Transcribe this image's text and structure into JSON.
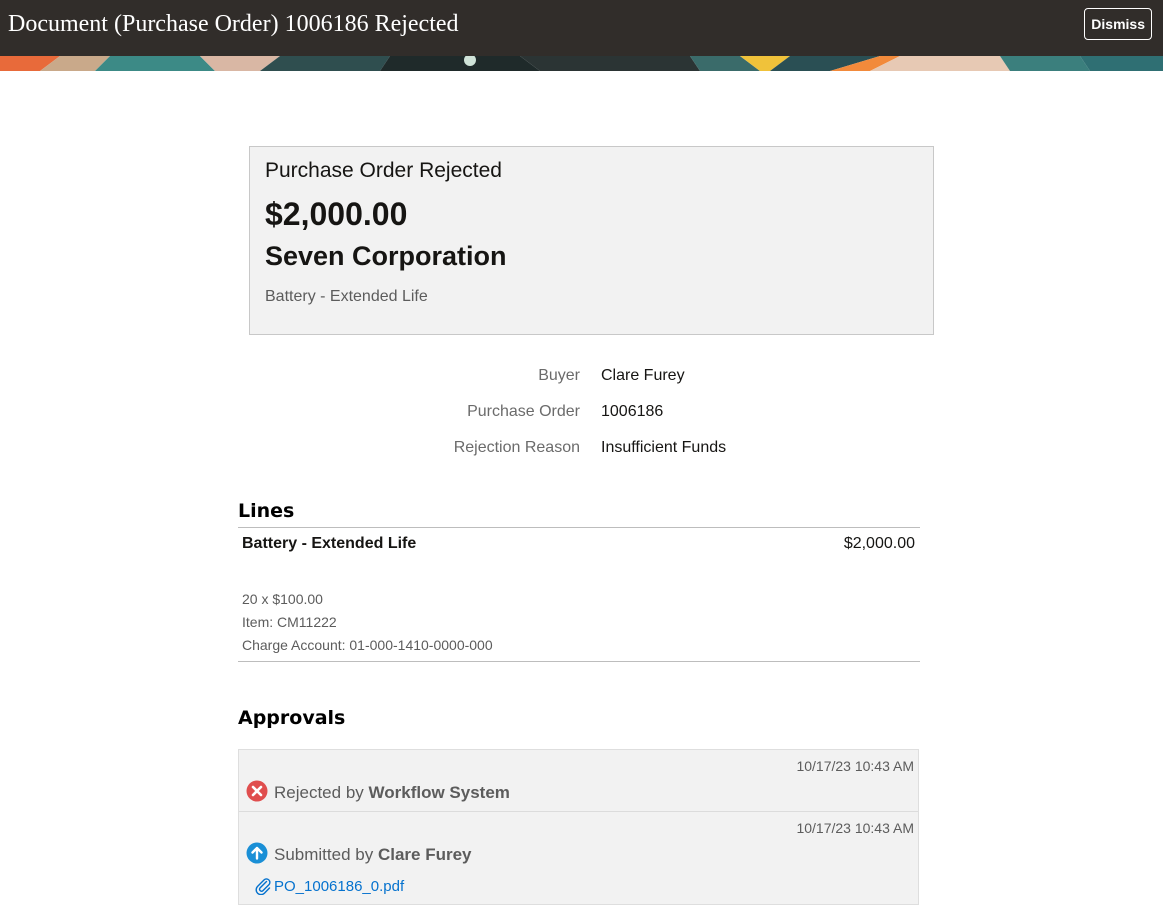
{
  "header": {
    "title": "Document (Purchase Order) 1006186 Rejected",
    "dismiss_label": "Dismiss"
  },
  "summary": {
    "title": "Purchase Order Rejected",
    "amount": "$2,000.00",
    "supplier": "Seven Corporation",
    "description": "Battery - Extended Life"
  },
  "fields": [
    {
      "label": "Buyer",
      "value": "Clare Furey"
    },
    {
      "label": "Purchase Order",
      "value": "1006186"
    },
    {
      "label": "Rejection Reason",
      "value": "Insufficient Funds"
    }
  ],
  "lines": {
    "heading": "Lines",
    "items": [
      {
        "name": "Battery - Extended Life",
        "amount": "$2,000.00",
        "quantity_price": "20 x $100.00",
        "item": "Item: CM11222",
        "charge_account": "Charge Account: 01-000-1410-0000-000"
      }
    ]
  },
  "approvals": {
    "heading": "Approvals",
    "entries": [
      {
        "timestamp": "10/17/23 10:43 AM",
        "action": "Rejected by",
        "actor": "Workflow System",
        "icon": "rejected-x-icon",
        "icon_color": "#e04e4e"
      },
      {
        "timestamp": "10/17/23 10:43 AM",
        "action": "Submitted by",
        "actor": "Clare Furey",
        "icon": "submitted-arrow-icon",
        "icon_color": "#1a8fd6",
        "attachment": "PO_1006186_0.pdf"
      }
    ]
  },
  "colors": {
    "header_bg": "#312d2a",
    "link": "#0572ce",
    "panel_bg": "#f2f2f2"
  }
}
